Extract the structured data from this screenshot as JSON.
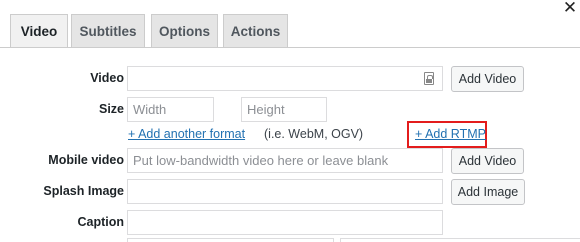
{
  "close": {
    "glyph": "✕"
  },
  "tabs": [
    {
      "label": "Video",
      "active": true
    },
    {
      "label": "Subtitles",
      "active": false
    },
    {
      "label": "Options",
      "active": false
    },
    {
      "label": "Actions",
      "active": false
    }
  ],
  "form": {
    "video": {
      "label": "Video",
      "value": "",
      "button": "Add Video"
    },
    "size": {
      "label": "Size",
      "width_placeholder": "Width",
      "height_placeholder": "Height"
    },
    "format": {
      "add_format_link": "+ Add another format",
      "hint": "(i.e. WebM, OGV)",
      "add_rtmp_link": "+ Add RTMP"
    },
    "mobile_video": {
      "label": "Mobile video",
      "placeholder": "Put low-bandwidth video here or leave blank",
      "button": "Add Video"
    },
    "splash_image": {
      "label": "Splash Image",
      "value": "",
      "button": "Add Image"
    },
    "caption": {
      "label": "Caption",
      "value": ""
    }
  },
  "highlight_color": "#e31c1c"
}
